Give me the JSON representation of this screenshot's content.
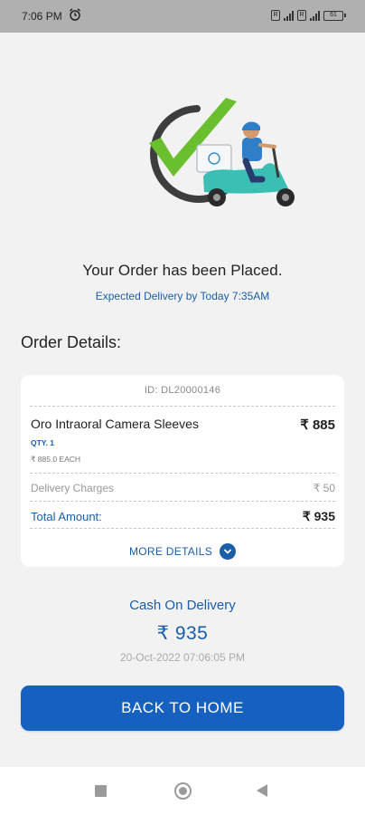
{
  "status_bar": {
    "time": "7:06 PM",
    "sim1_label": "R",
    "sim2_label": "R",
    "battery": "61"
  },
  "confirmation": {
    "title": "Your Order has been Placed.",
    "expected_delivery": "Expected Delivery by Today 7:35AM"
  },
  "order_details": {
    "heading": "Order Details:",
    "order_id": "ID: DL20000146",
    "item": {
      "name": "Oro Intraoral Camera Sleeves",
      "price": "₹ 885",
      "qty": "QTY. 1",
      "each": "₹ 885.0 EACH"
    },
    "delivery_label": "Delivery Charges",
    "delivery_value": "₹ 50",
    "total_label": "Total Amount:",
    "total_value": "₹ 935",
    "more_details": "MORE DETAILS"
  },
  "payment": {
    "method": "Cash On Delivery",
    "amount": "₹ 935",
    "timestamp": "20-Oct-2022 07:06:05 PM"
  },
  "actions": {
    "back_home": "BACK TO HOME"
  },
  "colors": {
    "primary": "#1660c0",
    "accent_text": "#1a5ea8",
    "check_green": "#6abf2e",
    "scooter_teal": "#3bbfb4"
  },
  "icons": [
    "alarm-icon",
    "signal-icon",
    "battery-icon",
    "checkmark-icon",
    "delivery-scooter-icon",
    "chevron-down-icon",
    "nav-recents-icon",
    "nav-home-icon",
    "nav-back-icon"
  ]
}
